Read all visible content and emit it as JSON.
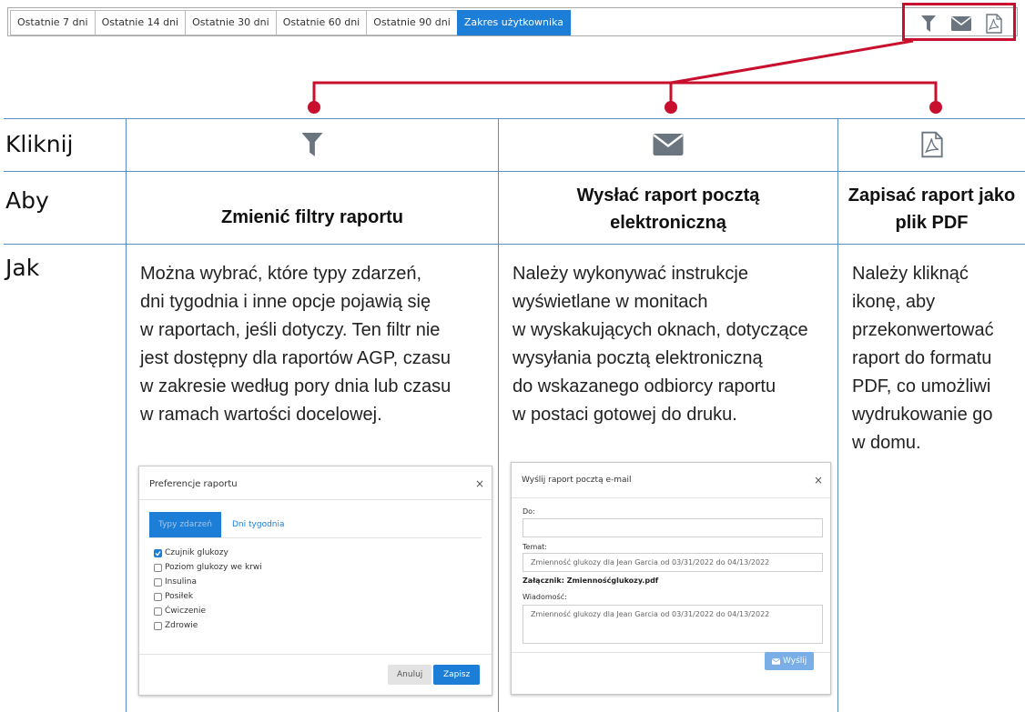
{
  "toolbar": {
    "ranges": [
      "Ostatnie 7 dni",
      "Ostatnie 14 dni",
      "Ostatnie 30 dni",
      "Ostatnie 60 dni",
      "Ostatnie 90 dni",
      "Zakres użytkownika"
    ],
    "active_range": "Zakres użytkownika",
    "icons": [
      "filter-icon",
      "mail-icon",
      "pdf-icon"
    ]
  },
  "colors": {
    "accent": "#1c7ed6",
    "highlight": "#c8102e",
    "grid": "#5a8fc5",
    "icon": "#6b7580"
  },
  "rows": {
    "click": "Kliknij",
    "to": "Aby",
    "how": "Jak"
  },
  "columns": {
    "filter": {
      "icon": "filter-icon",
      "heading": "Zmienić filtry raportu",
      "lines": [
        "Można wybrać, które typy zdarzeń,",
        "dni tygodnia i inne opcje pojawią się",
        "w raportach, jeśli dotyczy. Ten filtr nie",
        "jest dostępny dla raportów AGP, czasu",
        "w zakresie według pory dnia lub czasu",
        "w ramach wartości docelowej."
      ]
    },
    "email": {
      "icon": "mail-icon",
      "heading_lines": [
        "Wysłać raport pocztą",
        "elektroniczną"
      ],
      "lines": [
        "Należy wykonywać instrukcje",
        "wyświetlane w monitach",
        "w wyskakujących oknach, dotyczące",
        "wysyłania pocztą elektroniczną",
        "do wskazanego odbiorcy raportu",
        "w postaci gotowej do druku."
      ]
    },
    "pdf": {
      "icon": "pdf-icon",
      "heading_lines": [
        "Zapisać raport jako",
        "plik PDF"
      ],
      "lines": [
        "Należy kliknąć",
        "ikonę, aby",
        "przekonwertować",
        "raport do formatu",
        "PDF, co umożliwi",
        "wydrukowanie go",
        "w domu."
      ]
    }
  },
  "prefs_dialog": {
    "title": "Preferencje raportu",
    "close": "×",
    "tabs": [
      "Typy zdarzeń",
      "Dni tygodnia"
    ],
    "options": [
      {
        "label": "Czujnik glukozy",
        "checked": true
      },
      {
        "label": "Poziom glukozy we krwi",
        "checked": false
      },
      {
        "label": "Insulina",
        "checked": false
      },
      {
        "label": "Posiłek",
        "checked": false
      },
      {
        "label": "Ćwiczenie",
        "checked": false
      },
      {
        "label": "Zdrowie",
        "checked": false
      }
    ],
    "cancel": "Anuluj",
    "save": "Zapisz"
  },
  "email_dialog": {
    "title": "Wyślij raport pocztą e-mail",
    "close": "×",
    "to_label": "Do:",
    "to_value": "",
    "subject_label": "Temat:",
    "subject_value": "Zmienność glukozy dla Jean Garcia od 03/31/2022 do 04/13/2022",
    "attachment": "Załącznik: Zmiennośćglukozy.pdf",
    "message_label": "Wiadomość:",
    "message_value": "Zmienność glukozy dla Jean Garcia od 03/31/2022 do 04/13/2022",
    "send": "Wyślij"
  }
}
